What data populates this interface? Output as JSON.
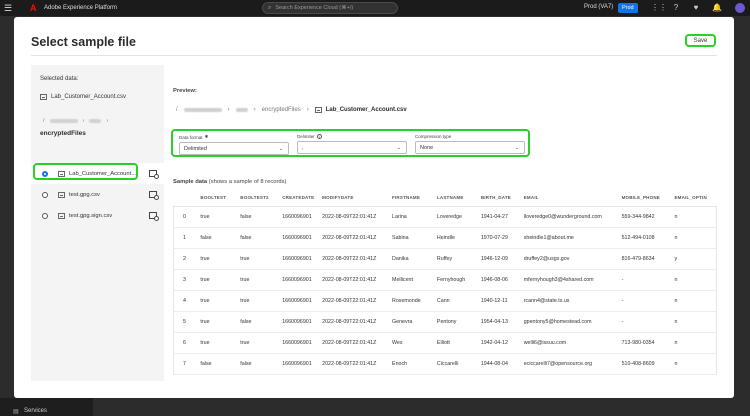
{
  "topbar": {
    "app_title": "Adobe Experience Platform",
    "search_placeholder": "Search Experience Cloud (⌘+/)",
    "org": "Prod (VA7)",
    "env_badge": "Prod"
  },
  "background": {
    "services_label": "Services"
  },
  "modal": {
    "title": "Select sample file",
    "save_label": "Save"
  },
  "left": {
    "heading": "Selected data:",
    "selected_file": "Lab_Customer_Account.csv",
    "breadcrumb_root": "/",
    "folder": "encryptedFiles",
    "files": [
      {
        "name": "Lab_Customer_Account...",
        "selected": true
      },
      {
        "name": "test.gpg.csv",
        "selected": false
      },
      {
        "name": "test.gpg.sign.csv",
        "selected": false
      }
    ]
  },
  "right": {
    "preview_label": "Preview:",
    "breadcrumb": {
      "root": "/",
      "folder": "encryptedFiles",
      "file": "Lab_Customer_Account.csv"
    },
    "options": {
      "data_format": {
        "label": "Data format",
        "required_mark": "✱",
        "value": "Delimited"
      },
      "delimiter": {
        "label": "Delimiter",
        "info": "i",
        "value": ","
      },
      "compression": {
        "label": "Compression type",
        "value": "None"
      }
    },
    "sample_title": "Sample data",
    "sample_note": "(shows a sample of 8 records)",
    "table": {
      "headers": [
        "",
        "BOOLTEST",
        "BOOLTEST2",
        "CREATEDATE",
        "MODIFYDATE",
        "FIRSTNAME",
        "LASTNAME",
        "BIRTH_DATE",
        "EMAIL",
        "MOBILE_PHONE",
        "EMAIL_OPTIN"
      ],
      "rows": [
        [
          "0",
          "true",
          "false",
          "1660096901",
          "2022-08-09T22:01:41Z",
          "Larina",
          "Loveredge",
          "1941-04-27",
          "lloveredge0@wunderground.com",
          "559-344-9842",
          "n"
        ],
        [
          "1",
          "false",
          "false",
          "1660096901",
          "2022-08-09T22:01:41Z",
          "Sabina",
          "Heindle",
          "1970-07-29",
          "sheindle1@about.me",
          "512-494-0108",
          "n"
        ],
        [
          "2",
          "true",
          "true",
          "1660096901",
          "2022-08-09T22:01:41Z",
          "Danika",
          "Ruffey",
          "1946-12-09",
          "druffey2@usgs.gov",
          "816-479-8634",
          "y"
        ],
        [
          "3",
          "true",
          "true",
          "1660096901",
          "2022-08-09T22:01:41Z",
          "Mellicent",
          "Fernyhough",
          "1946-08-06",
          "mfernyhough3@4shared.com",
          "-",
          "n"
        ],
        [
          "4",
          "true",
          "true",
          "1660096901",
          "2022-08-09T22:01:41Z",
          "Rosemonde",
          "Cann",
          "1940-12-11",
          "rcann4@state.tx.us",
          "-",
          "n"
        ],
        [
          "5",
          "true",
          "false",
          "1660096901",
          "2022-08-09T22:01:41Z",
          "Genevra",
          "Pentony",
          "1954-04-13",
          "gpentony5@homestead.com",
          "-",
          "n"
        ],
        [
          "6",
          "true",
          "true",
          "1660096901",
          "2022-08-09T22:01:41Z",
          "Wes",
          "Elliott",
          "1942-04-12",
          "welli6@issuu.com",
          "713-980-0354",
          "n"
        ],
        [
          "7",
          "false",
          "false",
          "1660096901",
          "2022-08-09T22:01:41Z",
          "Enoch",
          "Ciccarelli",
          "1944-08-04",
          "eciccarelli7@opensource.org",
          "510-408-8609",
          "n"
        ]
      ]
    }
  }
}
